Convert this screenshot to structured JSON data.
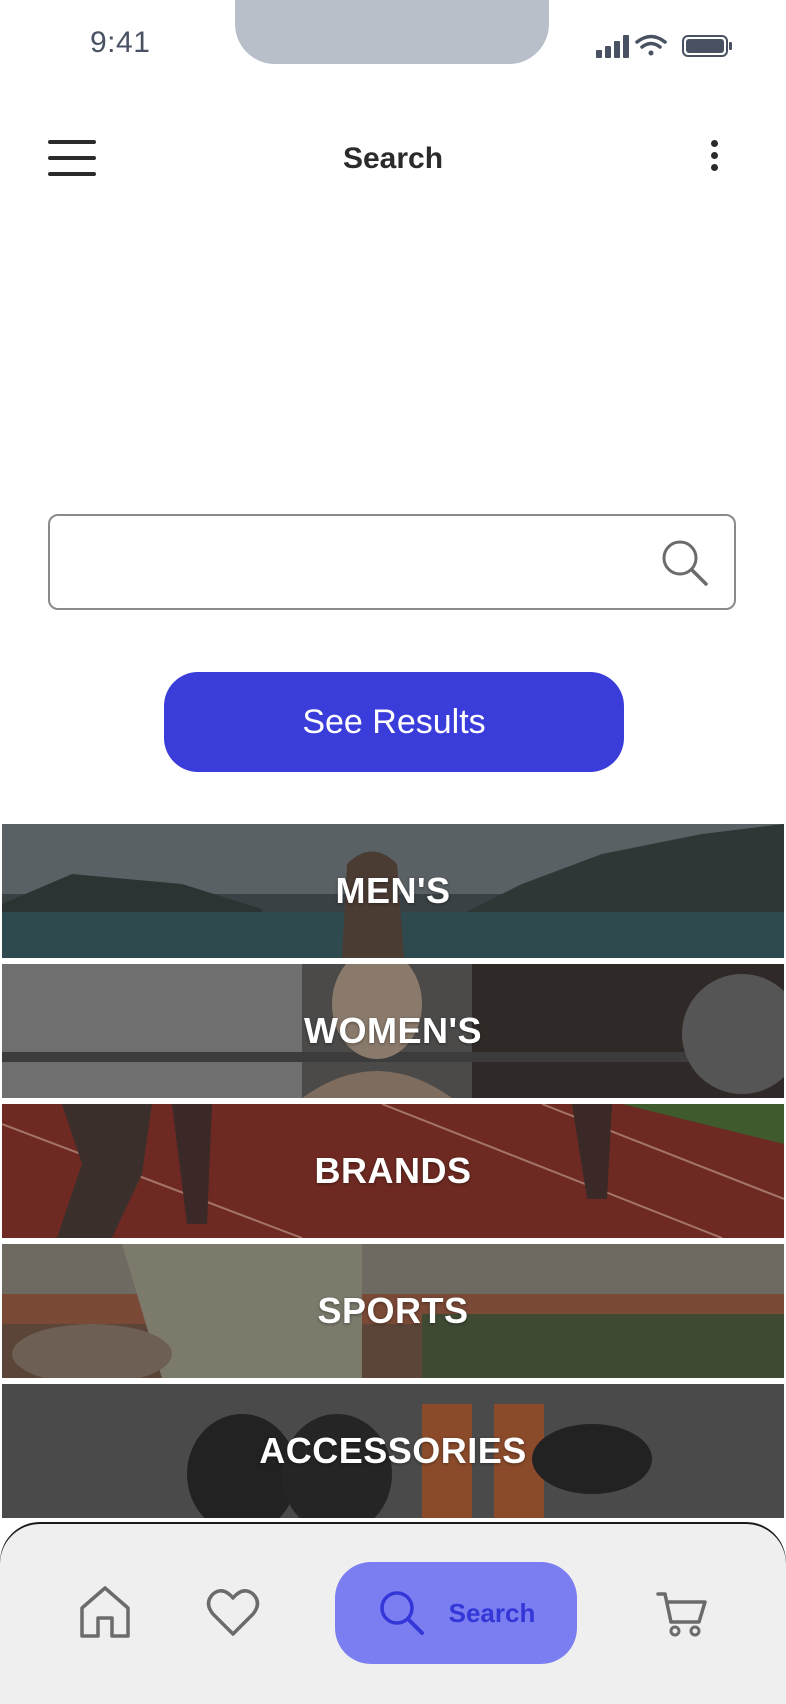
{
  "status_bar": {
    "time": "9:41"
  },
  "header": {
    "title": "Search",
    "menu_icon": "hamburger-menu-icon",
    "more_icon": "more-vertical-icon"
  },
  "search": {
    "value": "",
    "placeholder": "",
    "icon": "search-icon",
    "button_label": "See Results"
  },
  "categories": [
    {
      "label": "MEN'S"
    },
    {
      "label": "WOMEN'S"
    },
    {
      "label": "BRANDS"
    },
    {
      "label": "SPORTS"
    },
    {
      "label": "ACCESSORIES"
    }
  ],
  "bottom_nav": {
    "items": [
      {
        "icon": "home-icon",
        "label": ""
      },
      {
        "icon": "heart-icon",
        "label": ""
      },
      {
        "icon": "search-icon",
        "label": "Search",
        "active": true
      },
      {
        "icon": "cart-icon",
        "label": ""
      }
    ]
  },
  "colors": {
    "accent": "#3b3ddb",
    "nav_active_bg": "#7b7ef0",
    "nav_active_text": "#3437d8"
  }
}
